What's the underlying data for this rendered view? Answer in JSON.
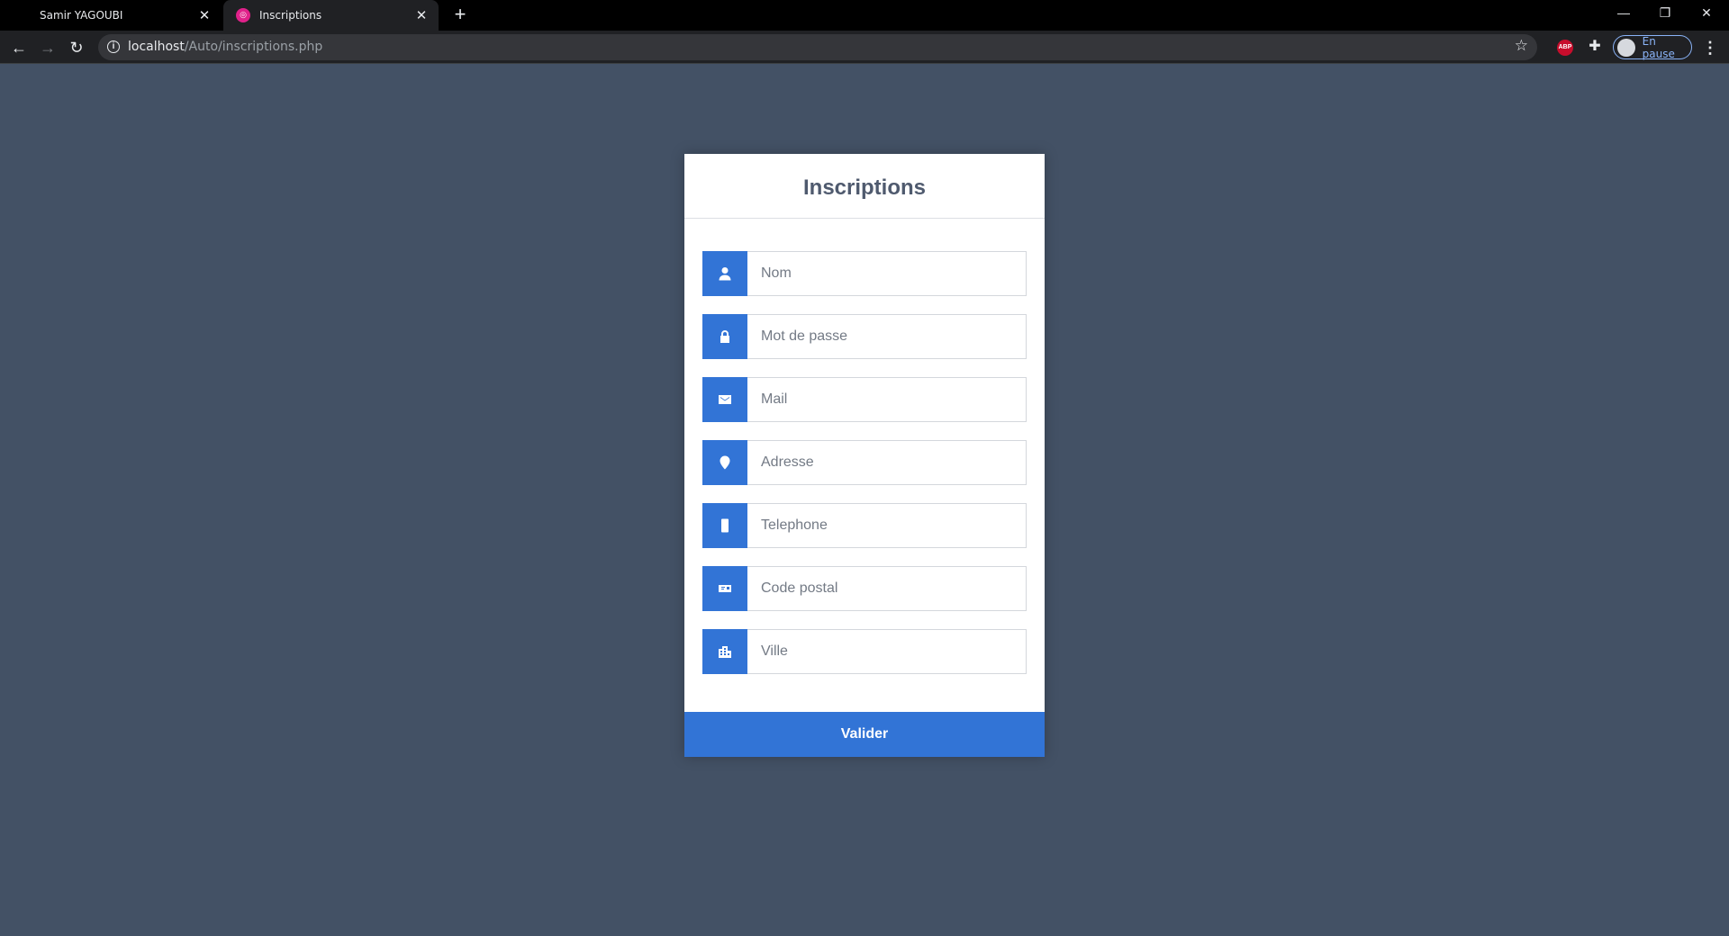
{
  "browser": {
    "tabs": [
      {
        "title": "Samir YAGOUBI"
      },
      {
        "title": "Inscriptions",
        "icon": "instagram-like-favicon"
      }
    ],
    "url_host": "localhost",
    "url_path": "/Auto/inscriptions.php",
    "profile_label": "En pause",
    "extension_abp": "ABP"
  },
  "form": {
    "title": "Inscriptions",
    "fields": [
      {
        "placeholder": "Nom",
        "icon": "user-icon"
      },
      {
        "placeholder": "Mot de passe",
        "icon": "lock-icon"
      },
      {
        "placeholder": "Mail",
        "icon": "envelope-icon"
      },
      {
        "placeholder": "Adresse",
        "icon": "map-marker-icon"
      },
      {
        "placeholder": "Telephone",
        "icon": "mobile-phone-icon"
      },
      {
        "placeholder": "Code postal",
        "icon": "postal-card-icon"
      },
      {
        "placeholder": "Ville",
        "icon": "city-building-icon"
      }
    ],
    "submit_label": "Valider"
  },
  "colors": {
    "page_background": "#435165",
    "accent": "#3274d6",
    "title_text": "#4f5a6e"
  }
}
